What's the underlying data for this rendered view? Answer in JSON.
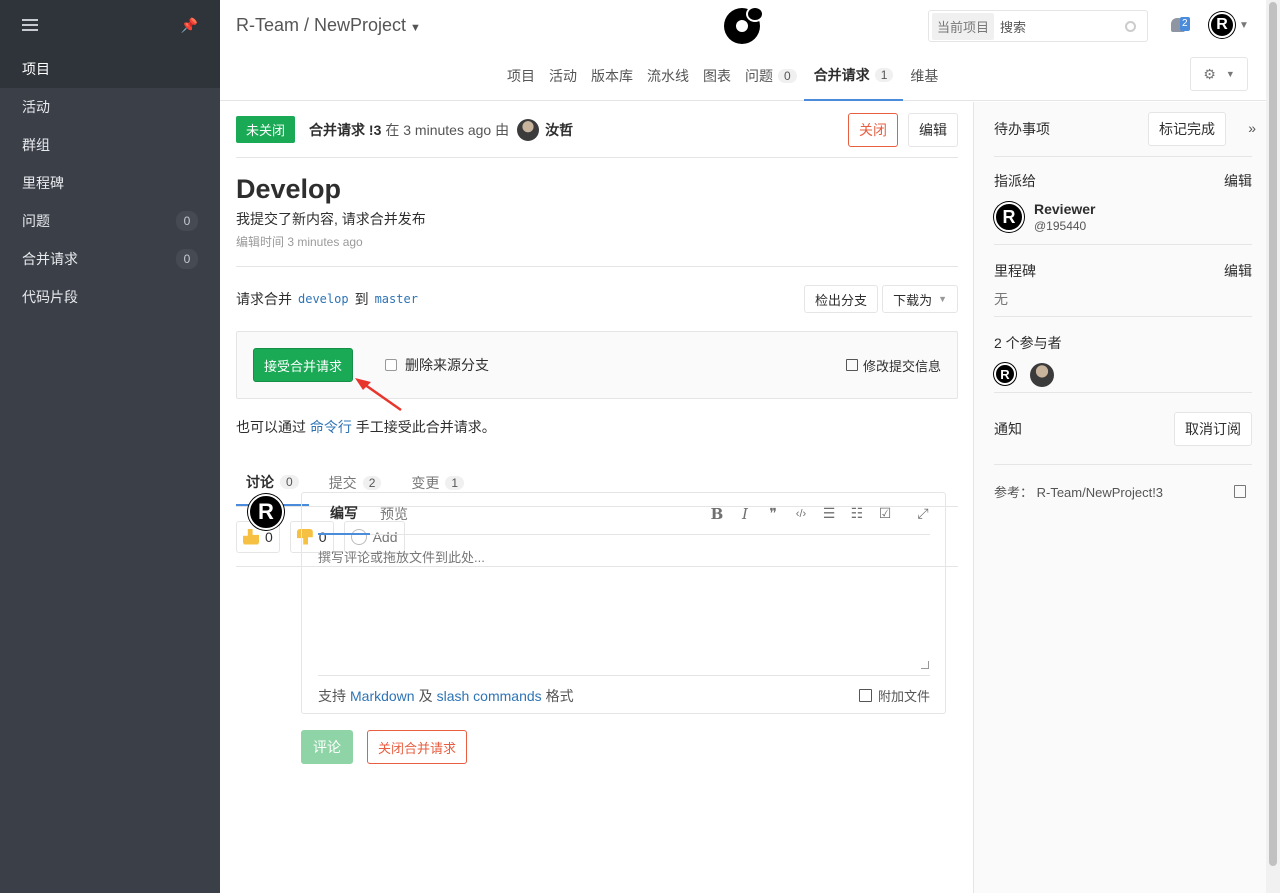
{
  "sidebar": {
    "items": [
      {
        "label": "项目",
        "count": null
      },
      {
        "label": "活动",
        "count": null
      },
      {
        "label": "群组",
        "count": null
      },
      {
        "label": "里程碑",
        "count": null
      },
      {
        "label": "问题",
        "count": "0"
      },
      {
        "label": "合并请求",
        "count": "0"
      },
      {
        "label": "代码片段",
        "count": null
      }
    ]
  },
  "header": {
    "project": "R-Team / NewProject",
    "search_scope": "当前项目",
    "search_placeholder": "搜索",
    "notification_count": "2",
    "user_initial": "R"
  },
  "subnav": {
    "tabs": [
      {
        "label": "项目"
      },
      {
        "label": "活动"
      },
      {
        "label": "版本库"
      },
      {
        "label": "流水线"
      },
      {
        "label": "图表"
      },
      {
        "label": "问题",
        "count": "0"
      },
      {
        "label": "合并请求",
        "count": "1"
      },
      {
        "label": "维基"
      }
    ]
  },
  "mr": {
    "status": "未关闭",
    "ref_label": "合并请求 !3",
    "ref_time": "在 3 minutes ago 由",
    "author": "汝哲",
    "close_btn": "关闭",
    "edit_btn": "编辑",
    "title": "Develop",
    "description": "我提交了新内容, 请求合并发布",
    "edited": "编辑时间 3 minutes ago",
    "branch_prefix": "请求合并",
    "source_branch": "develop",
    "branch_to": "到",
    "target_branch": "master",
    "checkout_btn": "检出分支",
    "download_btn": "下载为",
    "accept_btn": "接受合并请求",
    "remove_source_label": "删除来源分支",
    "modify_commit_label": "修改提交信息",
    "cli_prefix": "也可以通过",
    "cli_link": "命令行",
    "cli_suffix": "手工接受此合并请求。"
  },
  "discussion_tabs": [
    {
      "label": "讨论",
      "count": "0"
    },
    {
      "label": "提交",
      "count": "2"
    },
    {
      "label": "变更",
      "count": "1"
    }
  ],
  "awards": {
    "thumbs_up": "0",
    "thumbs_down": "0",
    "add": "Add"
  },
  "comment": {
    "write_tab": "编写",
    "preview_tab": "预览",
    "placeholder": "撰写评论或拖放文件到此处...",
    "toolbar": {
      "bold": "B",
      "italic": "I",
      "quote": "❞",
      "code": "‹/›",
      "ul": "☰",
      "ol": "☷",
      "task": "☑",
      "fullscreen": "⤢"
    },
    "footer_prefix": "支持",
    "markdown_link": "Markdown",
    "footer_and": "及",
    "slash_link": "slash commands",
    "footer_suffix": "格式",
    "attach": "附加文件",
    "submit_btn": "评论",
    "close_mr_btn": "关闭合并请求"
  },
  "rightbar": {
    "todo_label": "待办事项",
    "mark_done_btn": "标记完成",
    "assignee_label": "指派给",
    "assignee_edit": "编辑",
    "assignee_name": "Reviewer",
    "assignee_handle": "@195440",
    "milestone_label": "里程碑",
    "milestone_edit": "编辑",
    "milestone_value": "无",
    "participants_label": "2 个参与者",
    "notify_label": "通知",
    "unsubscribe_btn": "取消订阅",
    "reference": "参考： R-Team/NewProject!3"
  }
}
